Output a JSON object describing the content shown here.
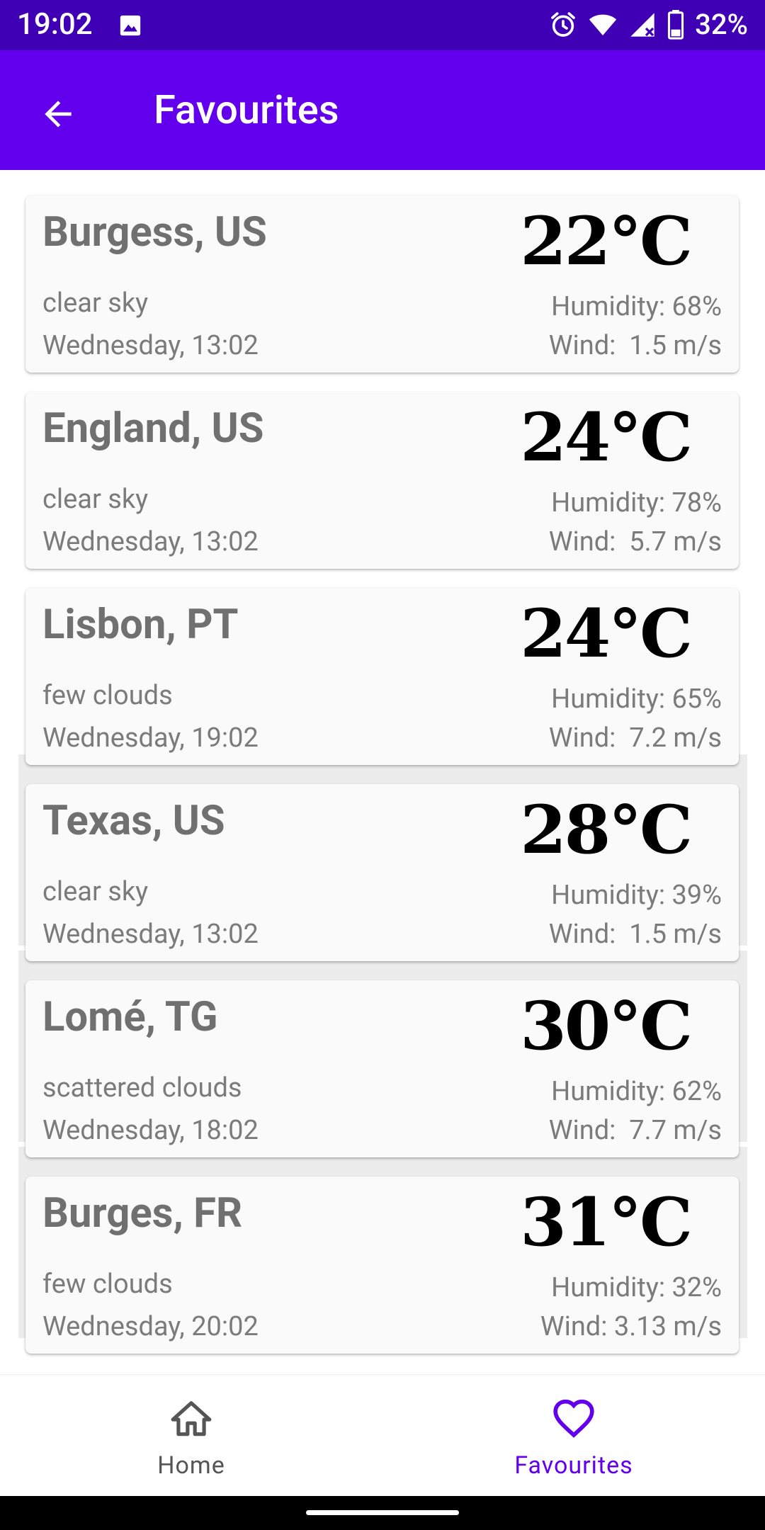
{
  "status_bar": {
    "time": "19:02",
    "battery": "32%",
    "icons": [
      "image-icon",
      "alarm-icon",
      "wifi-icon",
      "signal-icon",
      "battery-icon"
    ]
  },
  "app_bar": {
    "title": "Favourites",
    "back_icon": "arrow-back-icon"
  },
  "favourites": [
    {
      "city": "Burgess, US",
      "temp": "22°C",
      "description": "clear sky",
      "datetime": "Wednesday, 13:02",
      "humidity": "Humidity: 68%",
      "wind": "Wind:  1.5 m/s"
    },
    {
      "city": "England, US",
      "temp": "24°C",
      "description": "clear sky",
      "datetime": "Wednesday, 13:02",
      "humidity": "Humidity: 78%",
      "wind": "Wind:  5.7 m/s"
    },
    {
      "city": "Lisbon, PT",
      "temp": "24°C",
      "description": "few clouds",
      "datetime": "Wednesday, 19:02",
      "humidity": "Humidity: 65%",
      "wind": "Wind:  7.2 m/s"
    },
    {
      "city": "Texas, US",
      "temp": "28°C",
      "description": "clear sky",
      "datetime": "Wednesday, 13:02",
      "humidity": "Humidity: 39%",
      "wind": "Wind:  1.5 m/s"
    },
    {
      "city": "Lomé, TG",
      "temp": "30°C",
      "description": "scattered clouds",
      "datetime": "Wednesday, 18:02",
      "humidity": "Humidity: 62%",
      "wind": "Wind:  7.7 m/s"
    },
    {
      "city": "Burges, FR",
      "temp": "31°C",
      "description": "few clouds",
      "datetime": "Wednesday, 20:02",
      "humidity": "Humidity: 32%",
      "wind": "Wind: 3.13 m/s"
    }
  ],
  "bottom_nav": {
    "home_label": "Home",
    "favourites_label": "Favourites",
    "selected": "Favourites"
  },
  "colors": {
    "status_bar": "#3f00b5",
    "app_bar": "#6200ee",
    "accent": "#6200ee",
    "card_background": "#fafafa",
    "secondary_text": "#7b7b7b"
  }
}
